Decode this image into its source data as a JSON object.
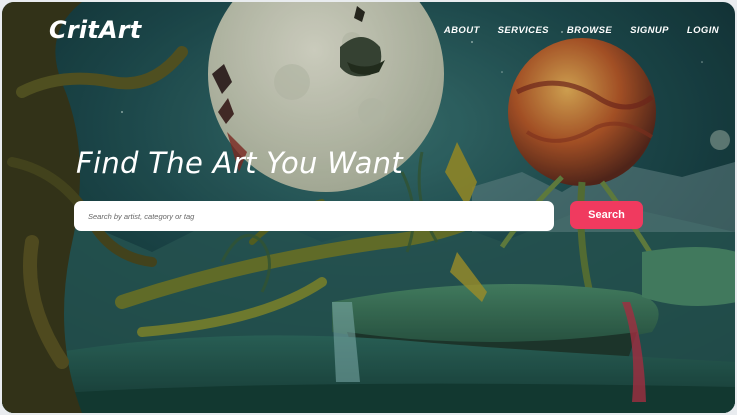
{
  "header": {
    "logo": "CritArt",
    "nav": [
      "ABOUT",
      "SERVICES",
      "BROWSE",
      "SIGNUP",
      "LOGIN"
    ]
  },
  "hero": {
    "title": "Find The Art You Want",
    "search_placeholder": "Search by artist, category or tag",
    "search_button": "Search"
  },
  "colors": {
    "accent": "#f03a5f",
    "sky_dark": "#0e2f35",
    "sky_light": "#2f6a6a",
    "foliage": "#3f6a3a",
    "moon": "#d9dcc8"
  }
}
